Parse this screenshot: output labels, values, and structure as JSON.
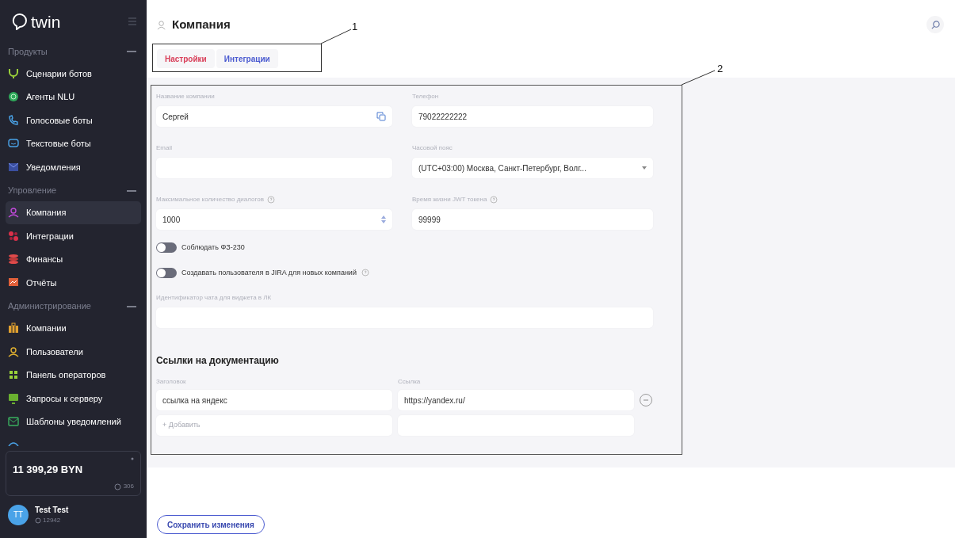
{
  "sidebar": {
    "logo": "twin",
    "sections": [
      {
        "title": "Продукты",
        "expanded": true,
        "items": [
          {
            "label": "Сценарии ботов",
            "selected": false
          },
          {
            "label": "Агенты NLU",
            "selected": false
          },
          {
            "label": "Голосовые боты",
            "selected": false
          },
          {
            "label": "Текстовые боты",
            "selected": false
          },
          {
            "label": "Уведомления",
            "selected": false
          }
        ]
      },
      {
        "title": "Упровление",
        "expanded": true,
        "items": [
          {
            "label": "Компания",
            "selected": true
          },
          {
            "label": "Интеграции",
            "selected": false
          },
          {
            "label": "Финансы",
            "selected": false
          },
          {
            "label": "Отчёты",
            "selected": false
          }
        ]
      },
      {
        "title": "Администрирование",
        "expanded": true,
        "items": [
          {
            "label": "Компании",
            "selected": false
          },
          {
            "label": "Пользователи",
            "selected": false
          },
          {
            "label": "Панель операторов",
            "selected": false
          },
          {
            "label": "Запросы к серверу",
            "selected": false
          },
          {
            "label": "Шаблоны уведомлений",
            "selected": false
          }
        ]
      }
    ],
    "balance": {
      "amount": "11 399,29 BYN",
      "count": "306"
    },
    "user": {
      "initials": "TT",
      "name": "Test Test",
      "id": "12942"
    }
  },
  "page": {
    "title": "Компания"
  },
  "tabs": [
    {
      "label": "Настройки",
      "selected": true
    },
    {
      "label": "Интеграции",
      "selected": false
    }
  ],
  "form": {
    "fields": [
      {
        "kind": "text",
        "label": "Название компании",
        "value": "Сергей",
        "help": false,
        "copy": true
      },
      {
        "kind": "text",
        "label": "Телефон",
        "value": "79022222222",
        "help": false,
        "copy": false
      },
      {
        "kind": "text",
        "label": "Email",
        "help": false,
        "copy": false
      },
      {
        "kind": "select",
        "label": "Часовой пояс",
        "value": "(UTC+03:00) Москва, Санкт-Петербург, Волг...",
        "help": false,
        "copy": false
      },
      {
        "kind": "number",
        "label": "Максимальное количество диалогов",
        "value": "1000",
        "help": true,
        "copy": false
      },
      {
        "kind": "text",
        "label": "Время жизни JWT токена",
        "value": "99999",
        "help": true,
        "copy": false
      }
    ],
    "toggles": [
      {
        "label": "Соблюдать ФЗ-230",
        "on": false,
        "help": false
      },
      {
        "label": "Создавать пользователя в JIRA для новых компаний",
        "on": false,
        "help": true
      }
    ],
    "chat_id": {
      "label": "Идентификатор чата для виджета в ЛК"
    },
    "docs": {
      "heading": "Ссылки на документацию",
      "title_label": "Заголовок",
      "link_label": "Ссылка",
      "rows": [
        {
          "title": "ссылка на яндекс",
          "link": "https://yandex.ru/"
        }
      ],
      "add_placeholder": "+ Добавить"
    }
  },
  "save_button": "Сохранить изменения",
  "annotations": [
    {
      "label": "1"
    },
    {
      "label": "2"
    }
  ]
}
